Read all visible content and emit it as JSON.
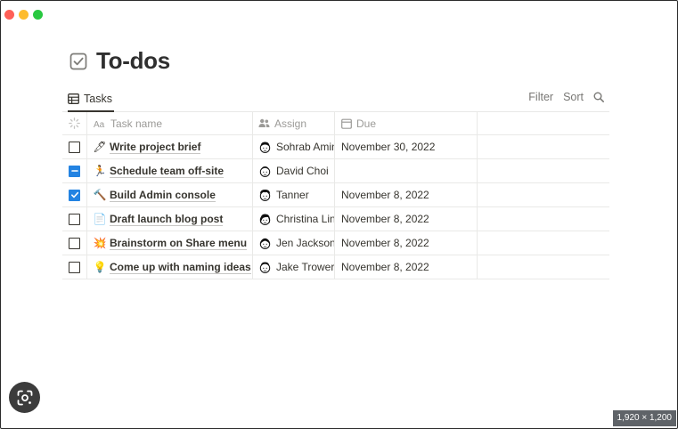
{
  "colors": {
    "accent": "#2383e2",
    "close": "#ff5f57",
    "minimize": "#febc2e",
    "maximize": "#28c840"
  },
  "page": {
    "title": "To-dos",
    "icon": "checkbox-icon"
  },
  "view_tab": {
    "label": "Tasks",
    "icon": "table-icon"
  },
  "toolbar": {
    "filter_label": "Filter",
    "sort_label": "Sort",
    "search_icon": "search-icon"
  },
  "columns": {
    "name": "Task name",
    "assign": "Assign",
    "due": "Due"
  },
  "tasks": [
    {
      "state": "unchecked",
      "emoji": "🖋",
      "name": "Write project brief",
      "assign": "Sohrab Amin",
      "due": "November 30, 2022"
    },
    {
      "state": "partial",
      "emoji": "🏃",
      "name": "Schedule team off-site",
      "assign": "David Choi",
      "due": ""
    },
    {
      "state": "checked",
      "emoji": "🔨",
      "name": "Build Admin console",
      "assign": "Tanner",
      "due": "November 8, 2022"
    },
    {
      "state": "unchecked",
      "emoji": "📄",
      "name": "Draft launch blog post",
      "assign": "Christina Lin",
      "due": "November 8, 2022"
    },
    {
      "state": "unchecked",
      "emoji": "💥",
      "name": "Brainstorm on Share menu",
      "assign": "Jen Jackson",
      "due": "November 8, 2022"
    },
    {
      "state": "unchecked",
      "emoji": "💡",
      "name": "Come up with naming ideas",
      "assign": "Jake Trower",
      "due": "November 8, 2022"
    }
  ],
  "overlay": {
    "size_badge": "1,920 × 1,200",
    "lens_icon": "lens-search-icon"
  }
}
